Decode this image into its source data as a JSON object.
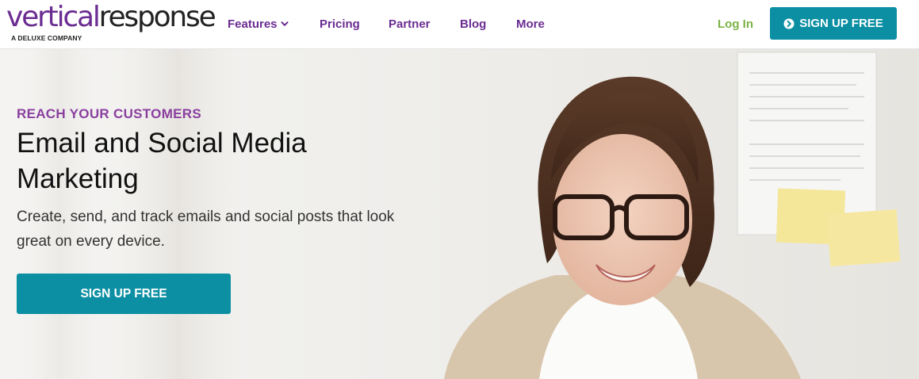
{
  "brand": {
    "logo_part1": "vertical",
    "logo_part2": "response",
    "tagline": "A DELUXE COMPANY",
    "primary_color": "#6a2c91",
    "accent_color": "#0c8fa3",
    "login_color": "#7bb246"
  },
  "nav": {
    "items": [
      {
        "label": "Features",
        "icon": "chevron-down-icon"
      },
      {
        "label": "Pricing"
      },
      {
        "label": "Partner"
      },
      {
        "label": "Blog"
      },
      {
        "label": "More"
      }
    ],
    "login_label": "Log In",
    "signup_label": "SIGN UP FREE",
    "signup_icon": "arrow-circle-right-icon"
  },
  "hero": {
    "eyebrow": "REACH YOUR CUSTOMERS",
    "headline": "Email and Social Media Marketing",
    "subtext": "Create, send, and track emails and social posts that look great on every device.",
    "cta_label": "SIGN UP FREE",
    "image_icon": "woman-with-glasses-photo"
  }
}
